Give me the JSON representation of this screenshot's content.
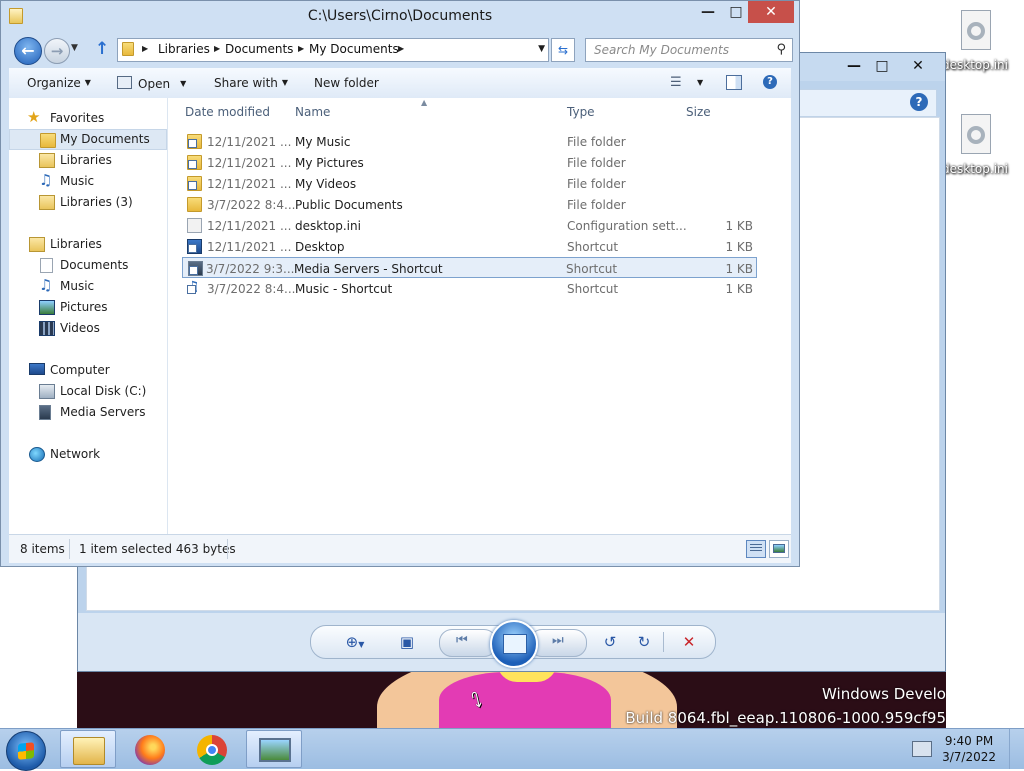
{
  "desktop": {
    "icons": [
      {
        "label": "desktop.ini"
      },
      {
        "label": "desktop.ini"
      }
    ],
    "watermark": {
      "line1": "Windows Develo",
      "line2": "Build 8064.fbl_eeap.110806-1000.959cf95"
    }
  },
  "explorer": {
    "title": "C:\\Users\\Cirno\\Documents",
    "breadcrumb": [
      "Libraries",
      "Documents",
      "My Documents"
    ],
    "search_placeholder": "Search My Documents",
    "toolbar": {
      "organize": "Organize",
      "open": "Open",
      "share_with": "Share with",
      "new_folder": "New folder"
    },
    "nav": [
      {
        "label": "Favorites",
        "icon": "star-icon",
        "indent": 0
      },
      {
        "label": "My Documents",
        "icon": "folder-icon",
        "indent": 1,
        "selected": true
      },
      {
        "label": "Libraries",
        "icon": "library-icon",
        "indent": 1
      },
      {
        "label": "Music",
        "icon": "music-icon",
        "indent": 1
      },
      {
        "label": "Libraries (3)",
        "icon": "library-icon",
        "indent": 1
      },
      {
        "label": "Libraries",
        "icon": "library-icon",
        "indent": 0
      },
      {
        "label": "Documents",
        "icon": "documents-icon",
        "indent": 1
      },
      {
        "label": "Music",
        "icon": "music-icon",
        "indent": 1
      },
      {
        "label": "Pictures",
        "icon": "pictures-icon",
        "indent": 1
      },
      {
        "label": "Videos",
        "icon": "videos-icon",
        "indent": 1
      },
      {
        "label": "Computer",
        "icon": "computer-icon",
        "indent": 0
      },
      {
        "label": "Local Disk (C:)",
        "icon": "disk-icon",
        "indent": 1
      },
      {
        "label": "Media Servers",
        "icon": "media-server-icon",
        "indent": 1
      },
      {
        "label": "Network",
        "icon": "network-icon",
        "indent": 0
      }
    ],
    "columns": {
      "date": "Date modified",
      "name": "Name",
      "type": "Type",
      "size": "Size"
    },
    "files": [
      {
        "date": "12/11/2021 ...",
        "name": "My Music",
        "type": "File folder",
        "size": "",
        "icon": "folder-shortcut-icon"
      },
      {
        "date": "12/11/2021 ...",
        "name": "My Pictures",
        "type": "File folder",
        "size": "",
        "icon": "folder-shortcut-icon"
      },
      {
        "date": "12/11/2021 ...",
        "name": "My Videos",
        "type": "File folder",
        "size": "",
        "icon": "folder-shortcut-icon"
      },
      {
        "date": "3/7/2022 8:4...",
        "name": "Public Documents",
        "type": "File folder",
        "size": "",
        "icon": "folder-icon"
      },
      {
        "date": "12/11/2021 ...",
        "name": "desktop.ini",
        "type": "Configuration sett...",
        "size": "1 KB",
        "icon": "config-file-icon"
      },
      {
        "date": "12/11/2021 ...",
        "name": "Desktop",
        "type": "Shortcut",
        "size": "1 KB",
        "icon": "desktop-shortcut-icon"
      },
      {
        "date": "3/7/2022 9:3...",
        "name": "Media Servers - Shortcut",
        "type": "Shortcut",
        "size": "1 KB",
        "icon": "media-shortcut-icon",
        "selected": true
      },
      {
        "date": "3/7/2022 8:4...",
        "name": "Music - Shortcut",
        "type": "Shortcut",
        "size": "1 KB",
        "icon": "music-shortcut-icon"
      }
    ],
    "status": {
      "count": "8 items",
      "selection": "1 item selected 463 bytes"
    }
  },
  "taskbar": {
    "apps": [
      {
        "name": "file-explorer",
        "active": true
      },
      {
        "name": "firefox",
        "active": false
      },
      {
        "name": "chrome",
        "active": false
      },
      {
        "name": "photo-viewer",
        "active": true
      }
    ],
    "clock_time": "9:40 PM",
    "clock_date": "3/7/2022"
  }
}
